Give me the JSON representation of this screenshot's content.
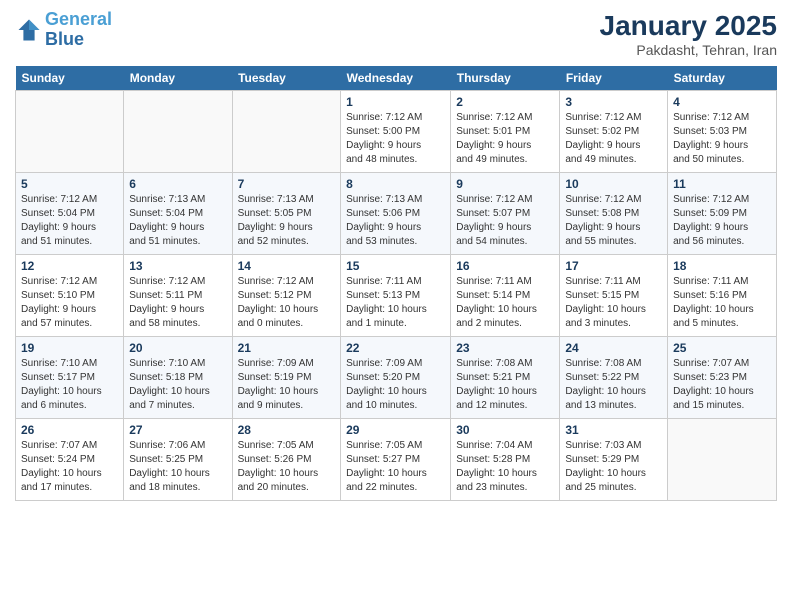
{
  "header": {
    "logo_line1": "General",
    "logo_line2": "Blue",
    "main_title": "January 2025",
    "subtitle": "Pakdasht, Tehran, Iran"
  },
  "calendar": {
    "days_of_week": [
      "Sunday",
      "Monday",
      "Tuesday",
      "Wednesday",
      "Thursday",
      "Friday",
      "Saturday"
    ],
    "weeks": [
      [
        {
          "day": "",
          "info": ""
        },
        {
          "day": "",
          "info": ""
        },
        {
          "day": "",
          "info": ""
        },
        {
          "day": "1",
          "info": "Sunrise: 7:12 AM\nSunset: 5:00 PM\nDaylight: 9 hours\nand 48 minutes."
        },
        {
          "day": "2",
          "info": "Sunrise: 7:12 AM\nSunset: 5:01 PM\nDaylight: 9 hours\nand 49 minutes."
        },
        {
          "day": "3",
          "info": "Sunrise: 7:12 AM\nSunset: 5:02 PM\nDaylight: 9 hours\nand 49 minutes."
        },
        {
          "day": "4",
          "info": "Sunrise: 7:12 AM\nSunset: 5:03 PM\nDaylight: 9 hours\nand 50 minutes."
        }
      ],
      [
        {
          "day": "5",
          "info": "Sunrise: 7:12 AM\nSunset: 5:04 PM\nDaylight: 9 hours\nand 51 minutes."
        },
        {
          "day": "6",
          "info": "Sunrise: 7:13 AM\nSunset: 5:04 PM\nDaylight: 9 hours\nand 51 minutes."
        },
        {
          "day": "7",
          "info": "Sunrise: 7:13 AM\nSunset: 5:05 PM\nDaylight: 9 hours\nand 52 minutes."
        },
        {
          "day": "8",
          "info": "Sunrise: 7:13 AM\nSunset: 5:06 PM\nDaylight: 9 hours\nand 53 minutes."
        },
        {
          "day": "9",
          "info": "Sunrise: 7:12 AM\nSunset: 5:07 PM\nDaylight: 9 hours\nand 54 minutes."
        },
        {
          "day": "10",
          "info": "Sunrise: 7:12 AM\nSunset: 5:08 PM\nDaylight: 9 hours\nand 55 minutes."
        },
        {
          "day": "11",
          "info": "Sunrise: 7:12 AM\nSunset: 5:09 PM\nDaylight: 9 hours\nand 56 minutes."
        }
      ],
      [
        {
          "day": "12",
          "info": "Sunrise: 7:12 AM\nSunset: 5:10 PM\nDaylight: 9 hours\nand 57 minutes."
        },
        {
          "day": "13",
          "info": "Sunrise: 7:12 AM\nSunset: 5:11 PM\nDaylight: 9 hours\nand 58 minutes."
        },
        {
          "day": "14",
          "info": "Sunrise: 7:12 AM\nSunset: 5:12 PM\nDaylight: 10 hours\nand 0 minutes."
        },
        {
          "day": "15",
          "info": "Sunrise: 7:11 AM\nSunset: 5:13 PM\nDaylight: 10 hours\nand 1 minute."
        },
        {
          "day": "16",
          "info": "Sunrise: 7:11 AM\nSunset: 5:14 PM\nDaylight: 10 hours\nand 2 minutes."
        },
        {
          "day": "17",
          "info": "Sunrise: 7:11 AM\nSunset: 5:15 PM\nDaylight: 10 hours\nand 3 minutes."
        },
        {
          "day": "18",
          "info": "Sunrise: 7:11 AM\nSunset: 5:16 PM\nDaylight: 10 hours\nand 5 minutes."
        }
      ],
      [
        {
          "day": "19",
          "info": "Sunrise: 7:10 AM\nSunset: 5:17 PM\nDaylight: 10 hours\nand 6 minutes."
        },
        {
          "day": "20",
          "info": "Sunrise: 7:10 AM\nSunset: 5:18 PM\nDaylight: 10 hours\nand 7 minutes."
        },
        {
          "day": "21",
          "info": "Sunrise: 7:09 AM\nSunset: 5:19 PM\nDaylight: 10 hours\nand 9 minutes."
        },
        {
          "day": "22",
          "info": "Sunrise: 7:09 AM\nSunset: 5:20 PM\nDaylight: 10 hours\nand 10 minutes."
        },
        {
          "day": "23",
          "info": "Sunrise: 7:08 AM\nSunset: 5:21 PM\nDaylight: 10 hours\nand 12 minutes."
        },
        {
          "day": "24",
          "info": "Sunrise: 7:08 AM\nSunset: 5:22 PM\nDaylight: 10 hours\nand 13 minutes."
        },
        {
          "day": "25",
          "info": "Sunrise: 7:07 AM\nSunset: 5:23 PM\nDaylight: 10 hours\nand 15 minutes."
        }
      ],
      [
        {
          "day": "26",
          "info": "Sunrise: 7:07 AM\nSunset: 5:24 PM\nDaylight: 10 hours\nand 17 minutes."
        },
        {
          "day": "27",
          "info": "Sunrise: 7:06 AM\nSunset: 5:25 PM\nDaylight: 10 hours\nand 18 minutes."
        },
        {
          "day": "28",
          "info": "Sunrise: 7:05 AM\nSunset: 5:26 PM\nDaylight: 10 hours\nand 20 minutes."
        },
        {
          "day": "29",
          "info": "Sunrise: 7:05 AM\nSunset: 5:27 PM\nDaylight: 10 hours\nand 22 minutes."
        },
        {
          "day": "30",
          "info": "Sunrise: 7:04 AM\nSunset: 5:28 PM\nDaylight: 10 hours\nand 23 minutes."
        },
        {
          "day": "31",
          "info": "Sunrise: 7:03 AM\nSunset: 5:29 PM\nDaylight: 10 hours\nand 25 minutes."
        },
        {
          "day": "",
          "info": ""
        }
      ]
    ]
  }
}
